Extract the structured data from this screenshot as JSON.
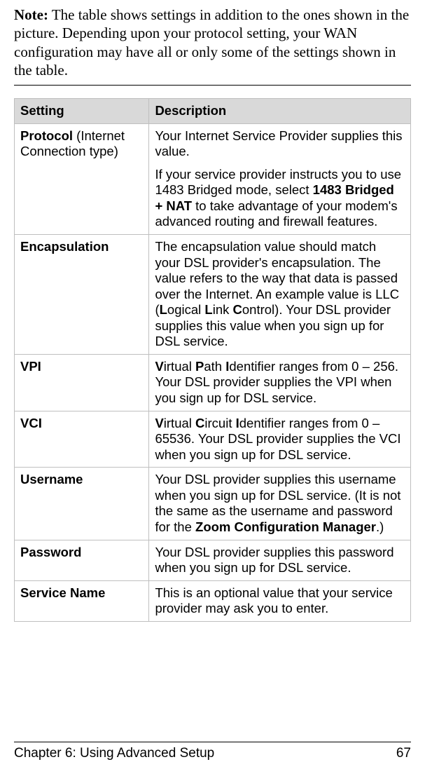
{
  "note": {
    "label": "Note:",
    "text": " The table shows settings in addition to the ones shown in the picture. Depending upon your protocol setting, your WAN configuration may have all or only some of the settings shown in the table."
  },
  "headers": {
    "setting": "Setting",
    "description": "Description"
  },
  "rows": {
    "protocol": {
      "setting_bold": "Protocol",
      "setting_rest": " (Internet Connection type)",
      "desc_p1": "Your Internet Service Provider supplies this value.",
      "desc_p2_a": "If your service provider instructs you to use 1483 Bridged mode, select ",
      "desc_p2_b": "1483 Bridged + NAT",
      "desc_p2_c": " to take advantage of your modem's advanced routing and firewall features."
    },
    "encapsulation": {
      "setting": "Encapsulation",
      "d1": "The encapsulation value should match your DSL provider's encapsulation. The value refers to the way that data is passed over the Internet. An example value is LLC (",
      "d2": "L",
      "d3": "ogical ",
      "d4": "L",
      "d5": "ink ",
      "d6": "C",
      "d7": "ontrol). Your DSL provider supplies this value when you sign up for DSL service."
    },
    "vpi": {
      "setting": "VPI",
      "d1": "V",
      "d2": "irtual ",
      "d3": "P",
      "d4": "ath ",
      "d5": "I",
      "d6": "dentifier ranges from 0 – 256. Your DSL provider supplies the VPI when you sign up for DSL service."
    },
    "vci": {
      "setting": "VCI",
      "d1": "V",
      "d2": "irtual ",
      "d3": "C",
      "d4": "ircuit ",
      "d5": "I",
      "d6": "dentifier ranges from 0 – 65536. Your DSL provider supplies the VCI when you sign up for DSL service."
    },
    "username": {
      "setting": "Username",
      "d1": "Your DSL provider supplies this username when you sign up for DSL service. (It is not the same as the username and password for the ",
      "d2": "Zoom Configuration Manager",
      "d3": ".)"
    },
    "password": {
      "setting": "Password",
      "desc": "Your DSL provider supplies this password when you sign up for DSL service."
    },
    "service": {
      "setting": "Service Name",
      "desc": "This is an optional value that your service provider may ask you to enter."
    }
  },
  "footer": {
    "chapter": "Chapter 6: Using Advanced Setup",
    "page": "67"
  }
}
